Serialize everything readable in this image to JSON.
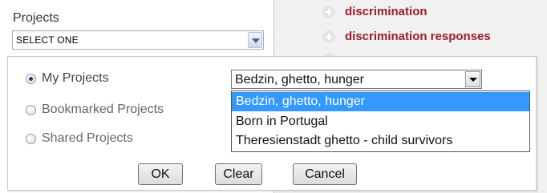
{
  "left": {
    "projects_label": "Projects",
    "select_value": "SELECT ONE"
  },
  "right": {
    "tree_items": [
      "discrimination",
      "discrimination responses"
    ]
  },
  "dialog": {
    "radios": [
      {
        "label": "My Projects",
        "checked": true
      },
      {
        "label": "Bookmarked Projects",
        "checked": false
      },
      {
        "label": "Shared Projects",
        "checked": false
      }
    ],
    "project_select_value": "Bedzin, ghetto, hunger",
    "dropdown_options": [
      {
        "label": "Bedzin, ghetto, hunger",
        "selected": true
      },
      {
        "label": "Born in Portugal",
        "selected": false
      },
      {
        "label": "Theresienstadt ghetto - child survivors",
        "selected": false
      }
    ],
    "buttons": {
      "ok": "OK",
      "clear": "Clear",
      "cancel": "Cancel"
    }
  },
  "colors": {
    "tree_item_text": "#9b1c2c",
    "selection_highlight": "#3399ff"
  }
}
